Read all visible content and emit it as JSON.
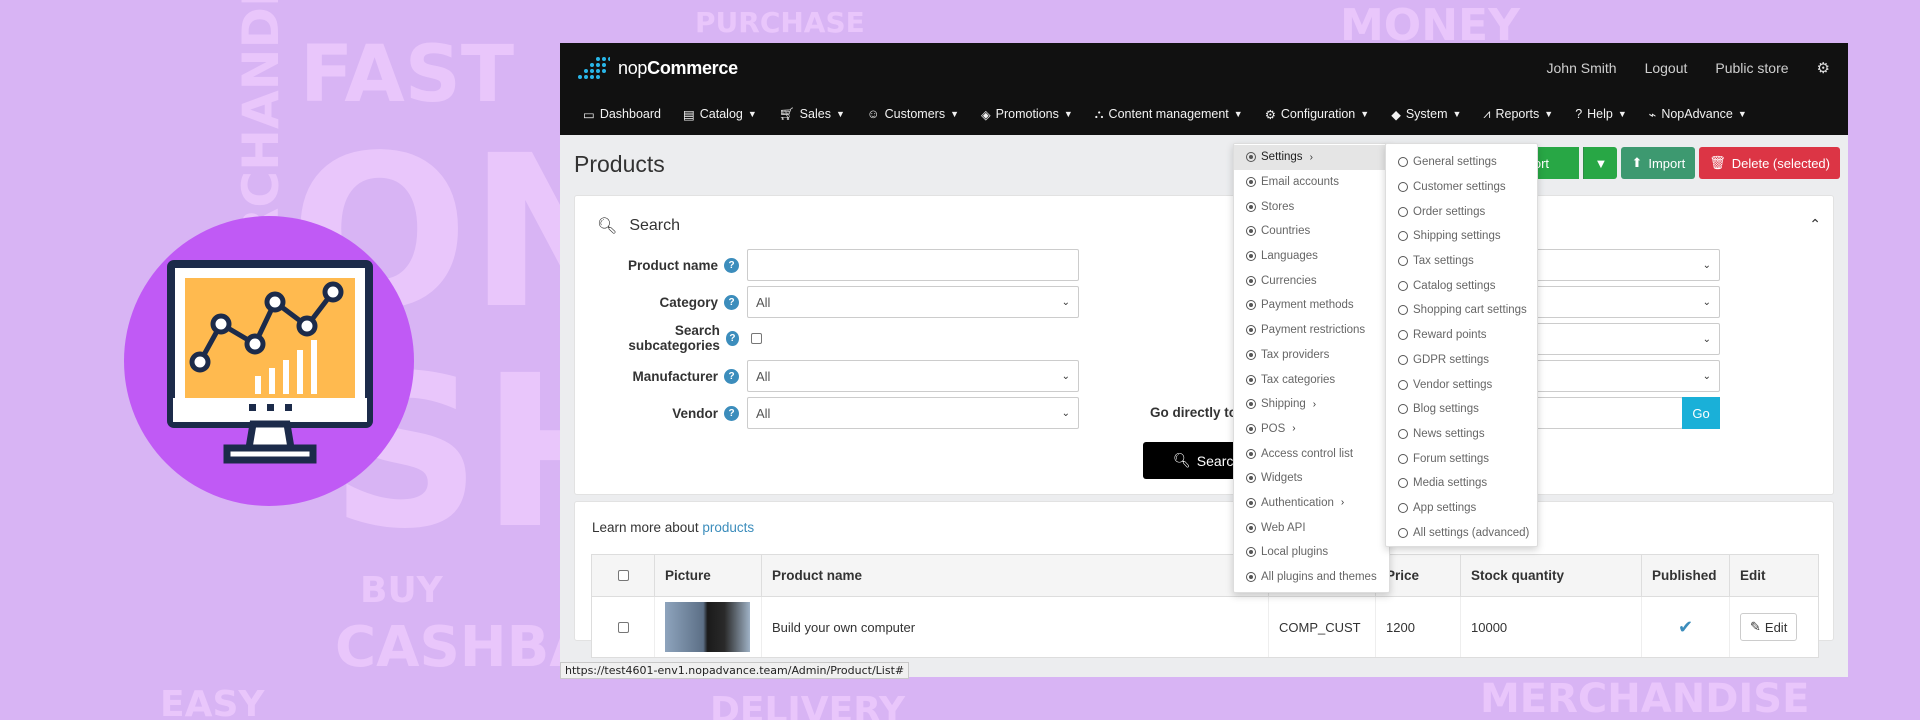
{
  "background_words": [
    "FAST",
    "PURCHASE",
    "MONEY",
    "MERCHANDISE",
    "ON",
    "SH",
    "BUY",
    "CASHBA",
    "EASY",
    "DELIVERY",
    "MERCHANDISE"
  ],
  "app": {
    "logo_prefix": "nop",
    "logo_suffix": "Commerce",
    "user_name": "John Smith",
    "logout": "Logout",
    "public_store": "Public store"
  },
  "nav": [
    {
      "label": "Dashboard",
      "icon": "monitor-icon",
      "caret": false
    },
    {
      "label": "Catalog",
      "icon": "book-icon",
      "caret": true
    },
    {
      "label": "Sales",
      "icon": "cart-icon",
      "caret": true
    },
    {
      "label": "Customers",
      "icon": "user-icon",
      "caret": true
    },
    {
      "label": "Promotions",
      "icon": "tags-icon",
      "caret": true
    },
    {
      "label": "Content management",
      "icon": "sitemap-icon",
      "caret": true
    },
    {
      "label": "Configuration",
      "icon": "gears-icon",
      "caret": true
    },
    {
      "label": "System",
      "icon": "cube-icon",
      "caret": true
    },
    {
      "label": "Reports",
      "icon": "chart-icon",
      "caret": true
    },
    {
      "label": "Help",
      "icon": "question-icon",
      "caret": true
    },
    {
      "label": "NopAdvance",
      "icon": "plug-icon",
      "caret": true
    }
  ],
  "page": {
    "title": "Products",
    "export": "Export",
    "import": "Import",
    "delete": "Delete (selected)"
  },
  "search": {
    "title": "Search",
    "product_name_label": "Product name",
    "category_label": "Category",
    "category_value": "All",
    "subcategories_label": "Search subcategories",
    "manufacturer_label": "Manufacturer",
    "manufacturer_value": "All",
    "vendor_label": "Vendor",
    "vendor_value": "All",
    "go_directly_label": "Go directly to",
    "go_button": "Go",
    "search_button": "Search"
  },
  "list": {
    "learn_more": "Learn more about",
    "learn_link": "products",
    "columns": [
      "Picture",
      "Product name",
      "",
      "Price",
      "Stock quantity",
      "Published",
      "Edit"
    ],
    "rows": [
      {
        "name": "Build your own computer",
        "sku": "COMP_CUST",
        "price": "1200",
        "stock": "10000",
        "published": true,
        "edit": "Edit"
      }
    ]
  },
  "status_url": "https://test4601-env1.nopadvance.team/Admin/Product/List#",
  "config_menu": [
    {
      "label": "Settings",
      "arrow": true,
      "active": true
    },
    {
      "label": "Email accounts"
    },
    {
      "label": "Stores"
    },
    {
      "label": "Countries"
    },
    {
      "label": "Languages"
    },
    {
      "label": "Currencies"
    },
    {
      "label": "Payment methods"
    },
    {
      "label": "Payment restrictions"
    },
    {
      "label": "Tax providers"
    },
    {
      "label": "Tax categories"
    },
    {
      "label": "Shipping",
      "arrow": true
    },
    {
      "label": "POS",
      "arrow": true
    },
    {
      "label": "Access control list"
    },
    {
      "label": "Widgets"
    },
    {
      "label": "Authentication",
      "arrow": true
    },
    {
      "label": "Web API"
    },
    {
      "label": "Local plugins"
    },
    {
      "label": "All plugins and themes"
    }
  ],
  "settings_menu": [
    "General settings",
    "Customer settings",
    "Order settings",
    "Shipping settings",
    "Tax settings",
    "Catalog settings",
    "Shopping cart settings",
    "Reward points",
    "GDPR settings",
    "Vendor settings",
    "Blog settings",
    "News settings",
    "Forum settings",
    "Media settings",
    "App settings",
    "All settings (advanced)"
  ],
  "colors": {
    "page_bg": "#d8b4f4",
    "circle": "#c05af5",
    "topbar": "#111111",
    "export": "#28a745",
    "import": "#3d9970",
    "delete": "#dc3545",
    "go": "#1ab0d8",
    "help": "#3c8dbc"
  }
}
